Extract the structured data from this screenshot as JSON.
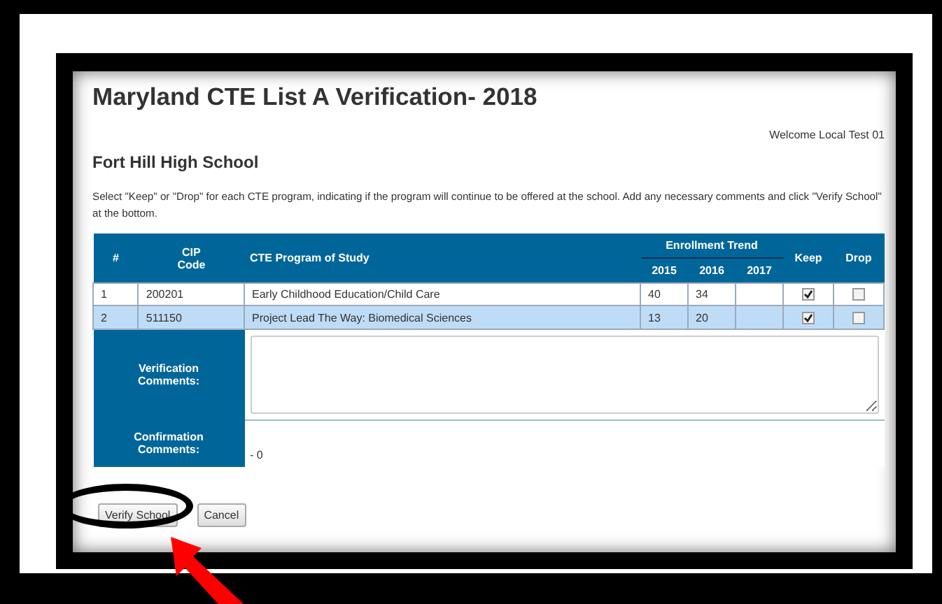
{
  "title": "Maryland CTE List A Verification- 2018",
  "welcome": "Welcome Local Test 01",
  "school": "Fort Hill High School",
  "instructions": "Select \"Keep\" or \"Drop\" for each CTE program, indicating if the program will continue to be offered at the school. Add any necessary comments and click \"Verify School\" at the bottom.",
  "table": {
    "columns": [
      "#",
      "CIP Code",
      "CTE Program of Study",
      "Enrollment Trend",
      "Keep",
      "Drop"
    ],
    "years": [
      "2015",
      "2016",
      "2017"
    ],
    "rows": [
      {
        "num": "1",
        "cip": "200201",
        "program": "Early Childhood Education/Child Care",
        "enrollment": [
          "40",
          "34"
        ],
        "keep": true,
        "drop": false,
        "selected": false
      },
      {
        "num": "2",
        "cip": "511150",
        "program": "Project Lead The Way: Biomedical Sciences",
        "enrollment": [
          "13",
          "20"
        ],
        "keep": true,
        "drop": false,
        "selected": true
      }
    ]
  },
  "verification_label": "Verification Comments:",
  "confirmation_label": "Confirmation Comments:",
  "confirmation_value": "- 0",
  "buttons": [
    "Verify School",
    "Cancel"
  ]
}
